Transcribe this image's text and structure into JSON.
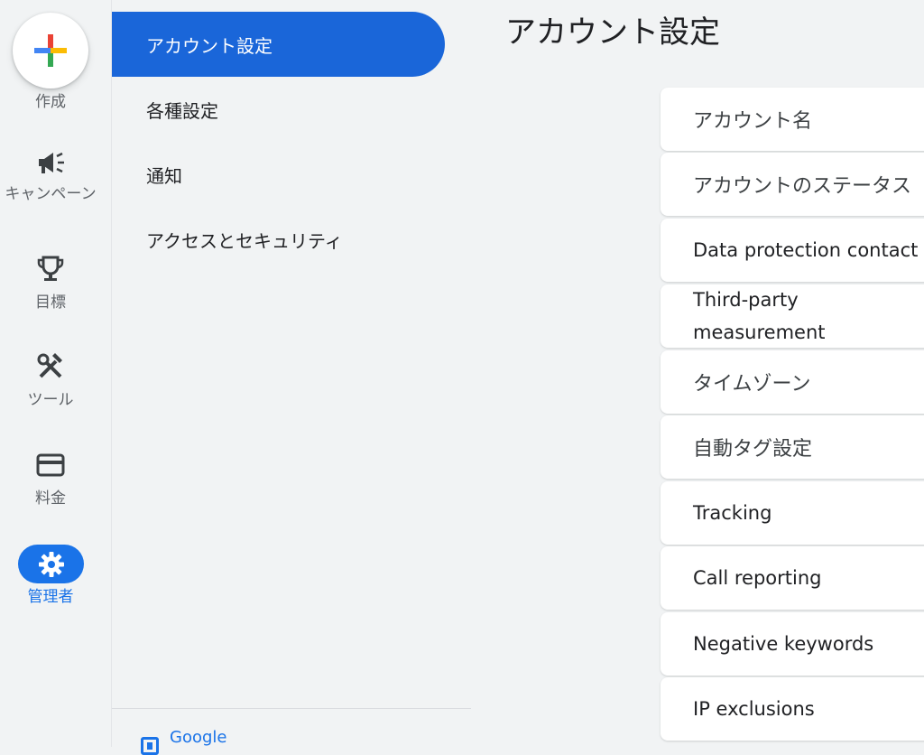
{
  "rail": {
    "create_label": "作成",
    "items": [
      {
        "label": "キャンペーン",
        "icon": "megaphone-icon"
      },
      {
        "label": "目標",
        "icon": "trophy-icon"
      },
      {
        "label": "ツール",
        "icon": "tools-icon"
      },
      {
        "label": "料金",
        "icon": "credit-card-icon"
      },
      {
        "label": "管理者",
        "icon": "gear-icon",
        "active": true
      }
    ]
  },
  "subnav": {
    "items": [
      {
        "label": "アカウント設定",
        "active": true
      },
      {
        "label": "各種設定"
      },
      {
        "label": "通知"
      },
      {
        "label": "アクセスとセキュリティ"
      }
    ],
    "footer_label": "Google"
  },
  "main": {
    "title": "アカウント設定",
    "rows": [
      "アカウント名",
      "アカウントのステータス",
      "Data protection contact",
      "Third-party measurement",
      "タイムゾーン",
      "自動タグ設定",
      "Tracking",
      "Call reporting",
      "Negative keywords",
      "IP exclusions"
    ]
  },
  "colors": {
    "accent": "#1a73e8",
    "active_nav": "#1a66d9",
    "background": "#f1f3f4",
    "card": "#ffffff"
  }
}
